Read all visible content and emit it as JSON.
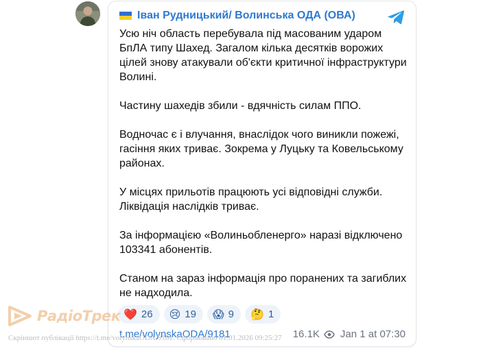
{
  "post": {
    "author": "Іван Рудницький/ Волинська ОДА (ОВА)",
    "flag_icon": "ukraine-flag",
    "platform_icon": "telegram-icon",
    "paragraphs": [
      "Усю ніч область перебувала під масованим ударом БпЛА типу Шахед. Загалом кілька десятків ворожих цілей знову атакували об'єкти критичної інфраструктури Волині.",
      "Частину шахедів збили - вдячність силам ППО.",
      "Водночас є і влучання, внаслідок чого виникли пожежі, гасіння яких триває. Зокрема у Луцьку та Ковельському районах.",
      "У місцях прильотів працюють усі відповідні служби. Ліквідація наслідків триває.",
      "За інформацією «Волиньобленерго» наразі відключено 103341 абонентів.",
      "Станом на зараз інформація про поранених та загиблих не надходила."
    ],
    "reactions": [
      {
        "emoji": "❤️",
        "count": "26"
      },
      {
        "emoji": "😢",
        "count": "19"
      },
      {
        "emoji": "😱",
        "count": "9"
      },
      {
        "emoji": "🤔",
        "count": "1"
      }
    ],
    "link": "t.me/volynskaODA/9181",
    "views": "16.1K",
    "timestamp": "Jan 1 at 07:30"
  },
  "watermark": {
    "brand": "РадіоТрек",
    "caption": "Скріншот публікації https://t.me/volynskaODA/9181. Сформовано 01.01.2026 09:25:27"
  },
  "colors": {
    "accent": "#2e79d0",
    "reaction_bg": "#eef3fa",
    "brand": "#e9a86a"
  }
}
